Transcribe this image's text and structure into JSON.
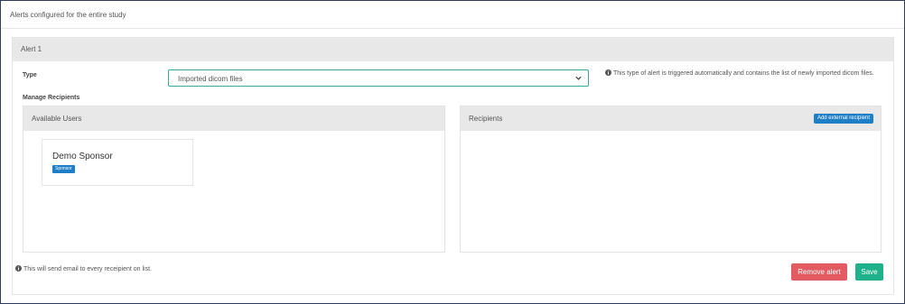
{
  "header": {
    "title": "Alerts configured for the entire study"
  },
  "alert": {
    "title": "Alert 1",
    "type_label": "Type",
    "type_value": "Imported dicom files",
    "type_info": "This type of alert is triggered automatically and contains the list of newly imported dicom files.",
    "manage_label": "Manage Recipients",
    "available_users": {
      "title": "Available Users",
      "users": [
        {
          "name": "Demo Sponsor",
          "role": "Sponsor"
        }
      ]
    },
    "recipients": {
      "title": "Recipients",
      "add_external_label": "Add external recipient"
    },
    "footer_note": "This will send email to every receipient on list.",
    "remove_label": "Remove alert",
    "save_label": "Save"
  },
  "colors": {
    "accent_blue": "#1f7fc6",
    "remove_red": "#e35a62",
    "save_green": "#1fb28a",
    "select_border": "#3aa798"
  },
  "icons": [
    "info-icon",
    "chevron-down-icon"
  ]
}
